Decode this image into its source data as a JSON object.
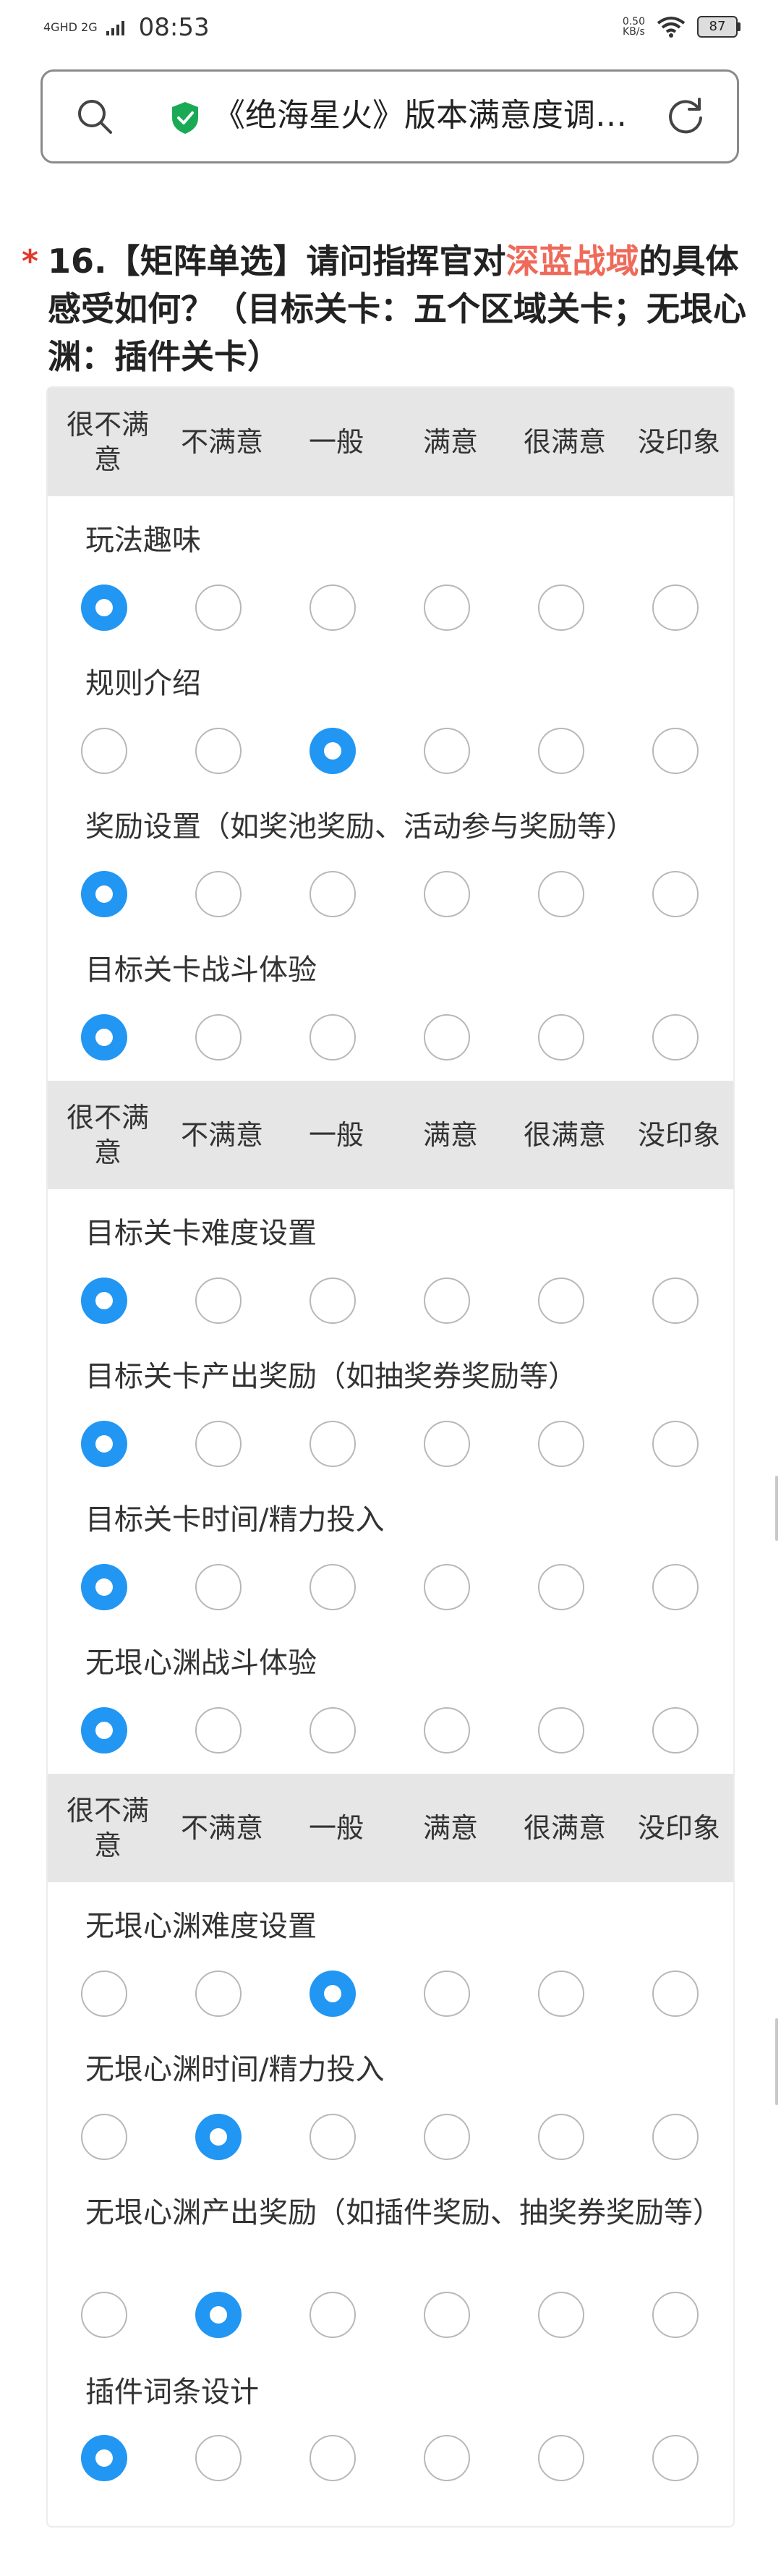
{
  "status": {
    "network": "4GHD 2G",
    "time": "08:53",
    "speed_value": "0.50",
    "speed_unit": "KB/s",
    "battery": "87"
  },
  "browser": {
    "page_title": "《绝海星火》版本满意度调…",
    "icons": [
      "search-icon",
      "shield-check-icon",
      "reload-icon"
    ]
  },
  "colors": {
    "accent": "#2196f3",
    "required": "#e0392b",
    "highlight": "#ef6a5a"
  },
  "question": {
    "required_mark": "*",
    "text_before": "16.【矩阵单选】请问指挥官对",
    "highlight": "深蓝战域",
    "text_after": "的具体感受如何？（目标关卡：五个区域关卡；无垠心渊：插件关卡）"
  },
  "options": [
    "很不满意",
    "不满意",
    "一般",
    "满意",
    "很满意",
    "没印象"
  ],
  "rows": [
    {
      "label": "玩法趣味",
      "selected": 0
    },
    {
      "label": "规则介绍",
      "selected": 2
    },
    {
      "label": "奖励设置（如奖池奖励、活动参与奖励等）",
      "selected": 0
    },
    {
      "label": "目标关卡战斗体验",
      "selected": 0
    },
    {
      "label": "目标关卡难度设置",
      "selected": 0
    },
    {
      "label": "目标关卡产出奖励（如抽奖券奖励等）",
      "selected": 0
    },
    {
      "label": "目标关卡时间/精力投入",
      "selected": 0
    },
    {
      "label": "无垠心渊战斗体验",
      "selected": 0
    },
    {
      "label": "无垠心渊难度设置",
      "selected": 2
    },
    {
      "label": "无垠心渊时间/精力投入",
      "selected": 1
    },
    {
      "label": "无垠心渊产出奖励（如插件奖励、抽奖券奖励等）",
      "selected": 1
    },
    {
      "label": "插件词条设计",
      "selected": 0
    }
  ]
}
